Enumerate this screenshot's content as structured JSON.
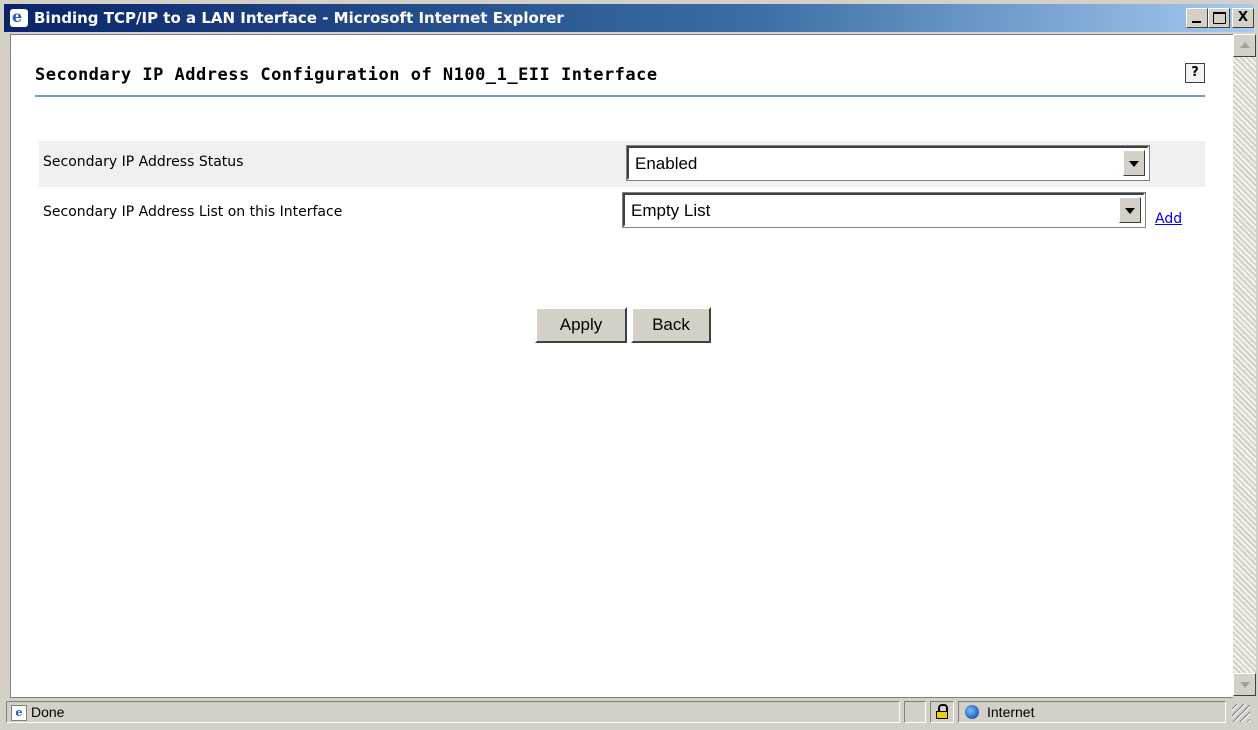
{
  "window": {
    "title": "Binding TCP/IP to a LAN Interface - Microsoft Internet Explorer",
    "controls": {
      "minimize": "minimize",
      "maximize": "maximize",
      "close": "X"
    }
  },
  "page": {
    "title": "Secondary IP Address Configuration of N100_1_EII Interface",
    "help_label": "?"
  },
  "form": {
    "status": {
      "label": "Secondary IP Address Status",
      "value": "Enabled"
    },
    "list": {
      "label": "Secondary IP Address List on this Interface",
      "value": "Empty List",
      "add_link": "Add"
    },
    "buttons": {
      "apply": "Apply",
      "back": "Back"
    }
  },
  "statusbar": {
    "text": "Done",
    "zone": "Internet"
  },
  "icons": {
    "title": "ie-logo-icon",
    "help": "help-icon",
    "done": "page-icon",
    "lock": "lock-icon",
    "zone": "globe-icon"
  },
  "colors": {
    "titlebar_start": "#0a246a",
    "titlebar_end": "#a6caf0",
    "title_rule": "#6d9bb5",
    "link": "#0000ee",
    "row_highlight": "#f0f0f0"
  }
}
